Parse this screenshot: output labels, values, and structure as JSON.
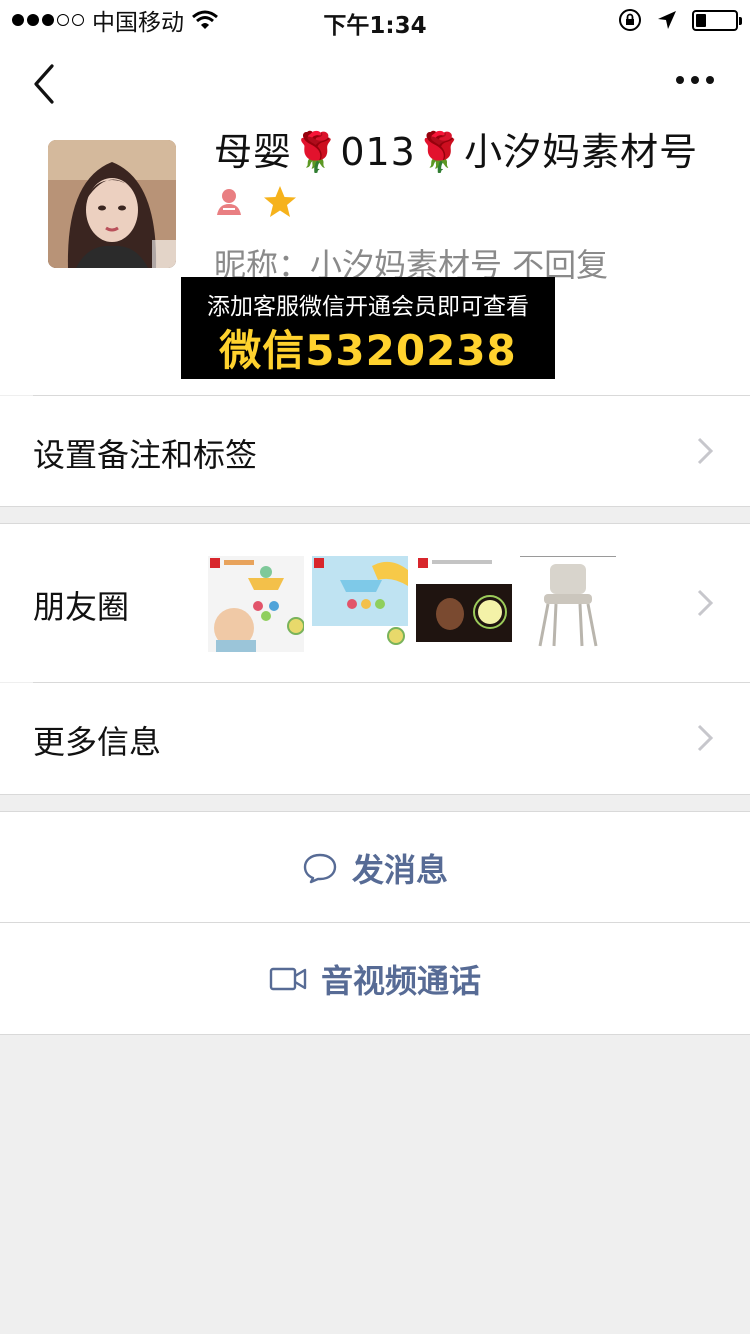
{
  "status_bar": {
    "carrier": "中国移动",
    "time": "下午1:34",
    "signal_bars_filled": 3,
    "signal_bars_total": 5,
    "battery_level": 0.25
  },
  "nav": {
    "back_icon": "chevron-left-icon",
    "more_icon": "more-dots-icon"
  },
  "profile": {
    "display_name": "母婴🌹013🌹小汐妈素材号",
    "nickname": "昵称：小汐妈素材号 不回复",
    "gender_icon": "female-icon",
    "star_icon": "star-icon",
    "colors": {
      "gender": "#e97f82",
      "star": "#f6b21b"
    }
  },
  "overlay_ad": {
    "line1": "添加客服微信开通会员即可查看",
    "line2": "微信5320238",
    "colors": {
      "background": "#000000",
      "line1": "#ffffff",
      "line2": "#ffd22e"
    }
  },
  "cells": {
    "remark": "设置备注和标签",
    "moments": "朋友圈",
    "more_info": "更多信息"
  },
  "actions": {
    "message": "发消息",
    "video_call": "音视频通话",
    "colors": {
      "link": "#576b95"
    }
  }
}
